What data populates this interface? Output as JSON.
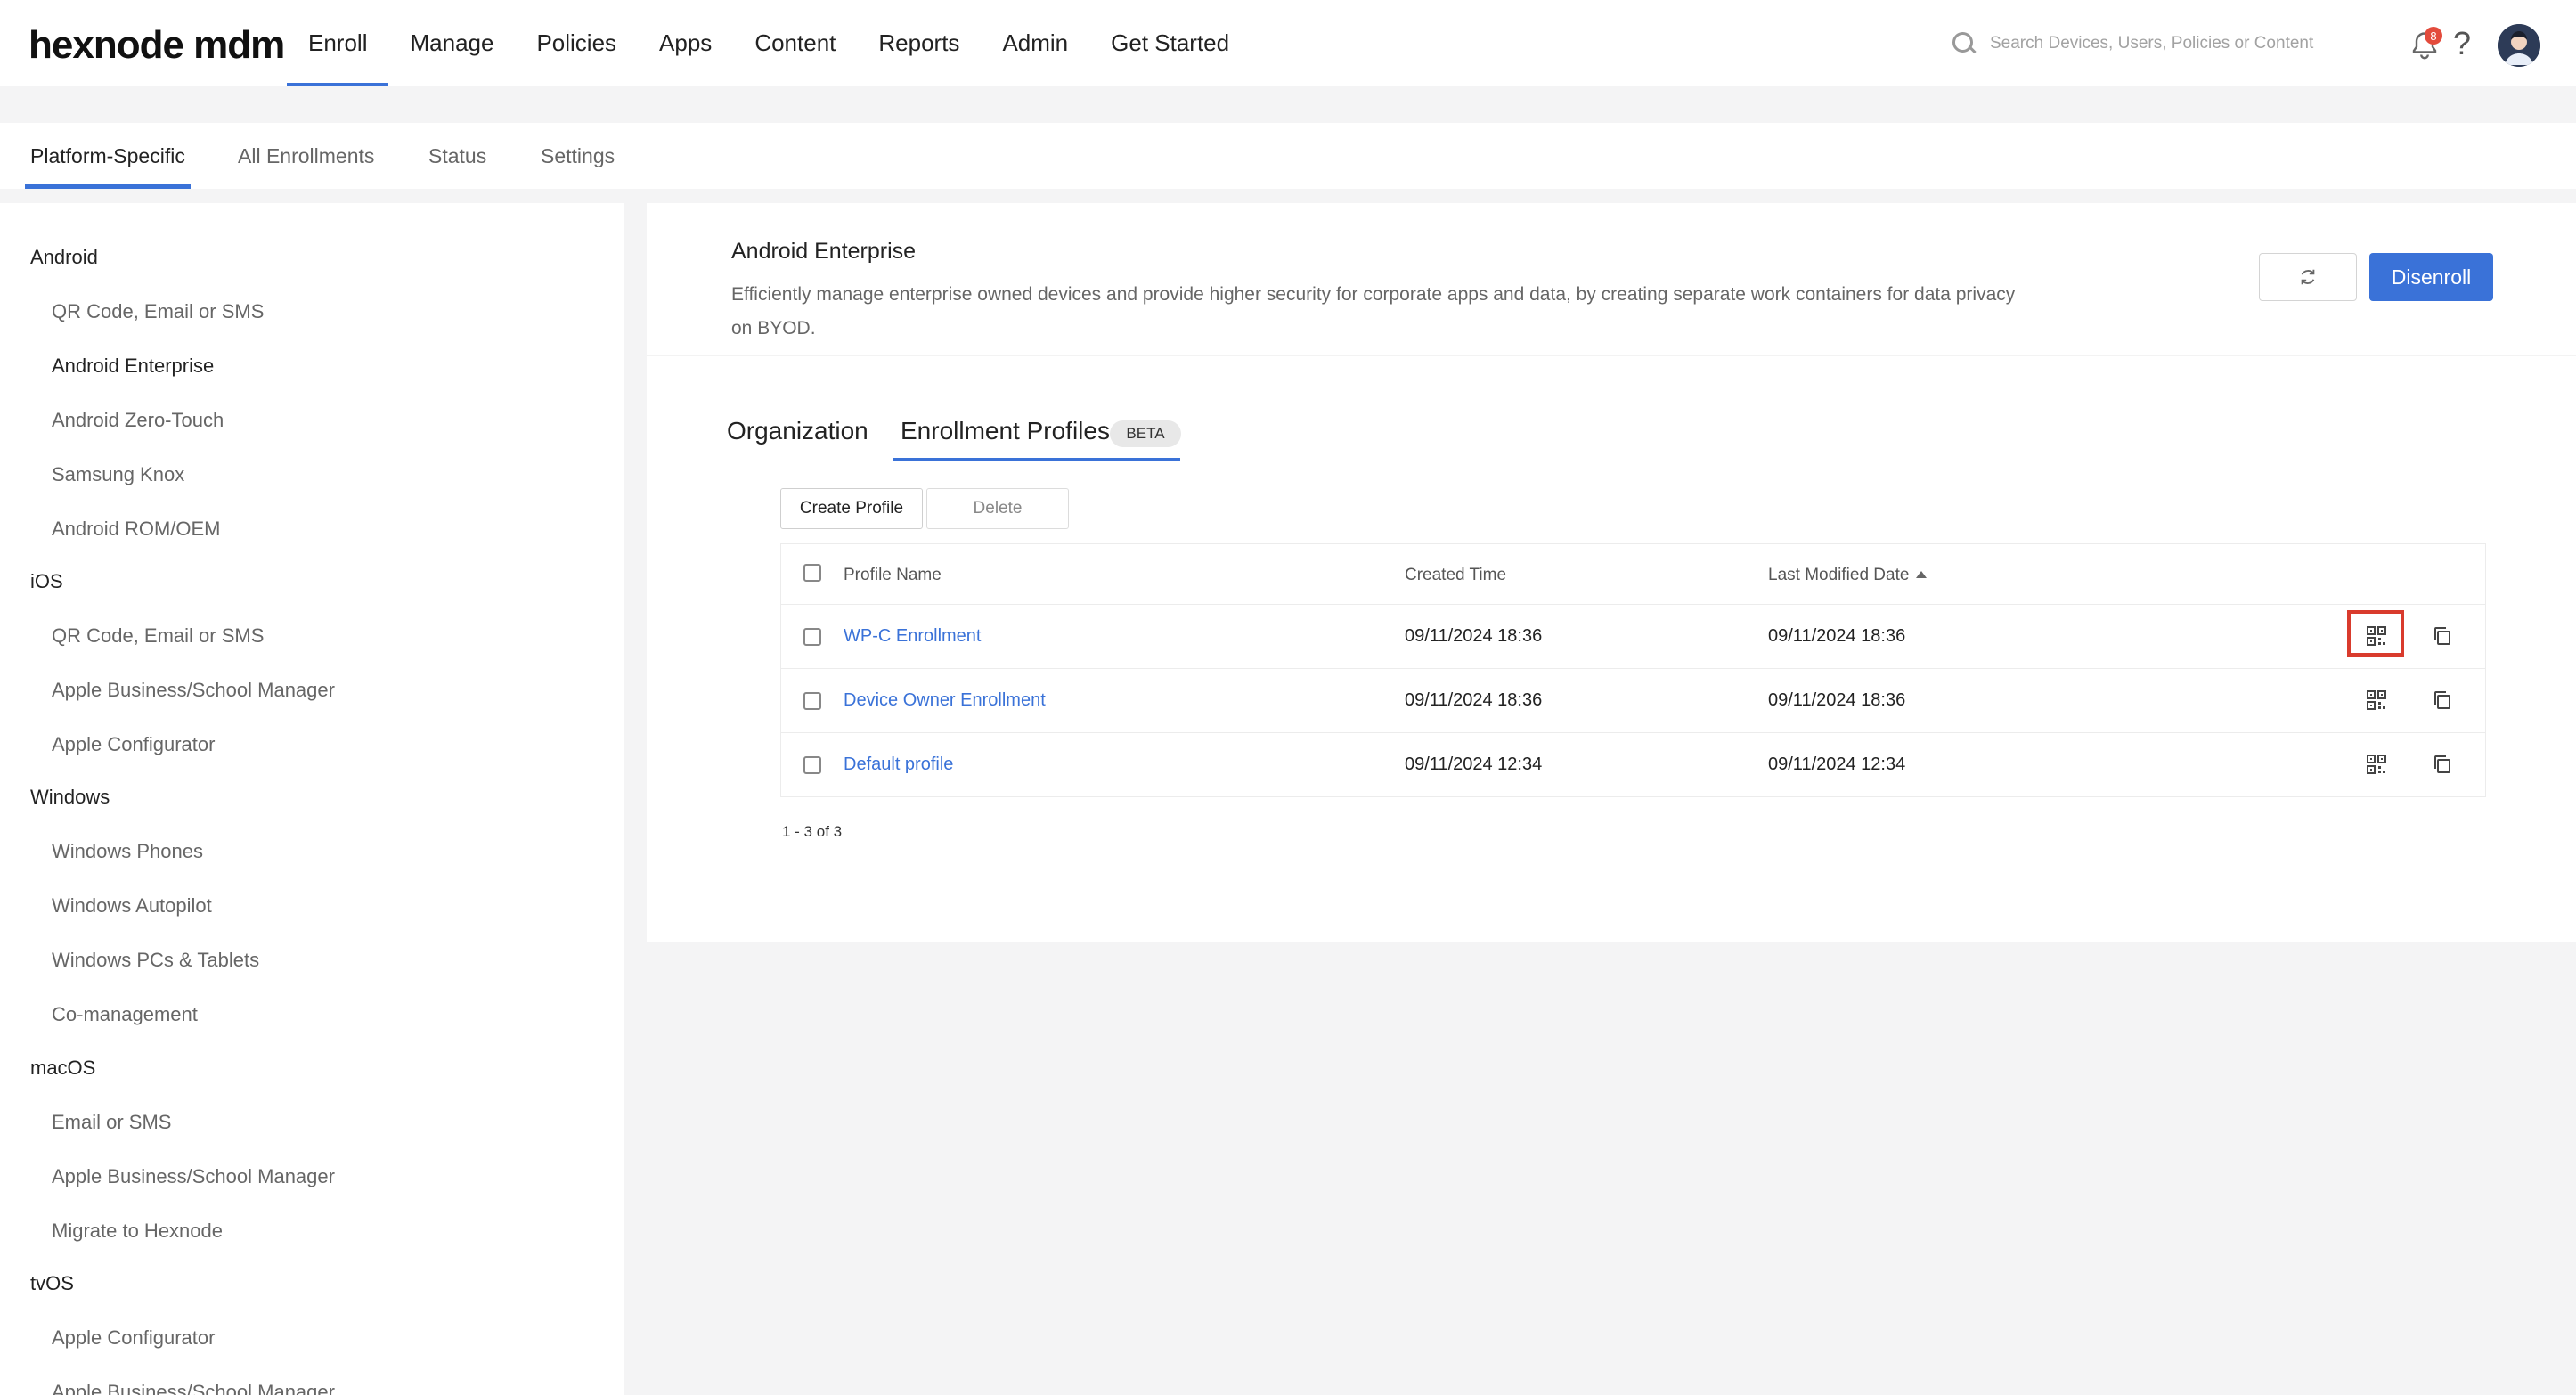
{
  "header": {
    "logo": "hexnode mdm",
    "nav": [
      "Enroll",
      "Manage",
      "Policies",
      "Apps",
      "Content",
      "Reports",
      "Admin",
      "Get Started"
    ],
    "search_placeholder": "Search Devices, Users, Policies or Content",
    "notification_count": "8",
    "help_label": "?"
  },
  "subtabs": [
    "Platform-Specific",
    "All Enrollments",
    "Status",
    "Settings"
  ],
  "sidebar": {
    "groups": [
      {
        "title": "Android",
        "items": [
          "QR Code, Email or SMS",
          "Android Enterprise",
          "Android Zero-Touch",
          "Samsung Knox",
          "Android ROM/OEM"
        ]
      },
      {
        "title": "iOS",
        "items": [
          "QR Code, Email or SMS",
          "Apple Business/School Manager",
          "Apple Configurator"
        ]
      },
      {
        "title": "Windows",
        "items": [
          "Windows Phones",
          "Windows Autopilot",
          "Windows PCs & Tablets",
          "Co-management"
        ]
      },
      {
        "title": "macOS",
        "items": [
          "Email or SMS",
          "Apple Business/School Manager",
          "Migrate to Hexnode"
        ]
      },
      {
        "title": "tvOS",
        "items": [
          "Apple Configurator",
          "Apple Business/School Manager"
        ]
      }
    ]
  },
  "main": {
    "title": "Android Enterprise",
    "description": "Efficiently manage enterprise owned devices and provide higher security for corporate apps and data, by creating separate work containers for data privacy on BYOD.",
    "disenroll_label": "Disenroll",
    "tabs": [
      "Organization",
      "Enrollment Profiles"
    ],
    "beta_label": "BETA",
    "create_label": "Create Profile",
    "delete_label": "Delete",
    "table": {
      "columns": [
        "Profile Name",
        "Created Time",
        "Last Modified Date"
      ],
      "rows": [
        {
          "name": "WP-C Enrollment",
          "created": "09/11/2024 18:36",
          "modified": "09/11/2024 18:36"
        },
        {
          "name": "Device Owner Enrollment",
          "created": "09/11/2024 18:36",
          "modified": "09/11/2024 18:36"
        },
        {
          "name": "Default profile",
          "created": "09/11/2024 12:34",
          "modified": "09/11/2024 12:34"
        }
      ]
    },
    "pager": "1 - 3 of 3"
  },
  "colors": {
    "accent": "#3a72d8",
    "highlight": "#d93b2d",
    "badge": "#e34b3c"
  },
  "icons": [
    "search-icon",
    "bell-icon",
    "help-icon",
    "avatar",
    "refresh-icon",
    "qr-code-icon",
    "copy-icon",
    "sort-ascending-icon"
  ]
}
